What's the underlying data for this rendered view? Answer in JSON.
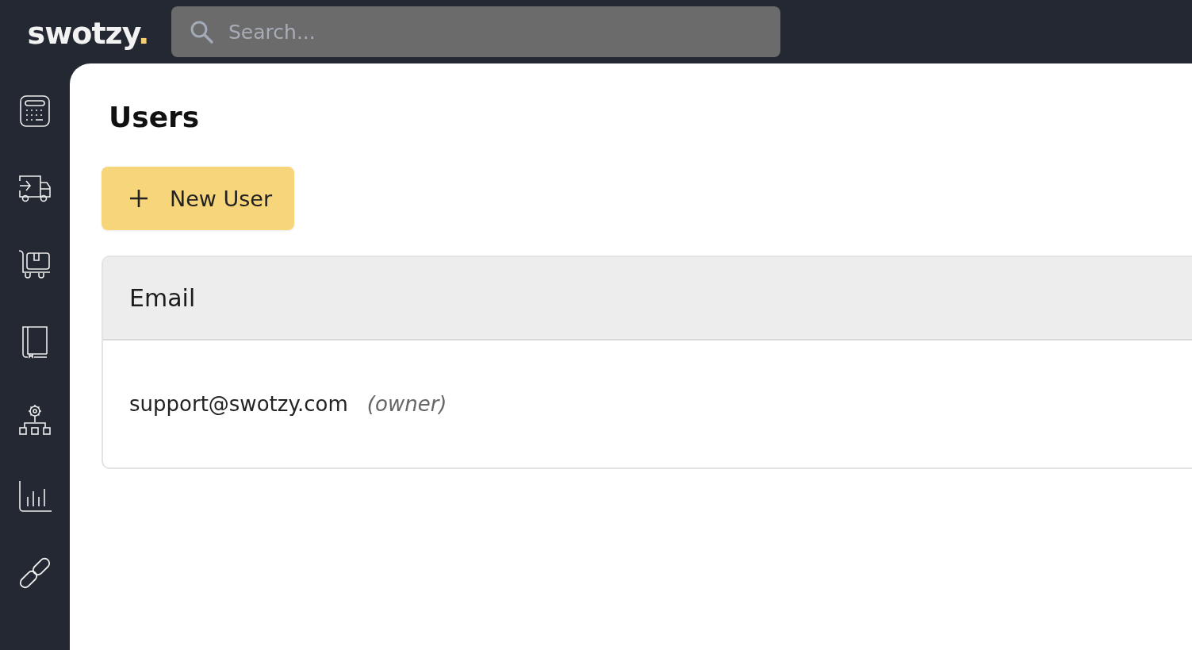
{
  "logo": {
    "text": "swotzy",
    "mark": "."
  },
  "search": {
    "placeholder": "Search..."
  },
  "page": {
    "title": "Users"
  },
  "new_button": {
    "label": "New User"
  },
  "table": {
    "columns": [
      "Email"
    ],
    "rows": [
      {
        "email": "support@swotzy.com",
        "role": "(owner)"
      }
    ]
  }
}
